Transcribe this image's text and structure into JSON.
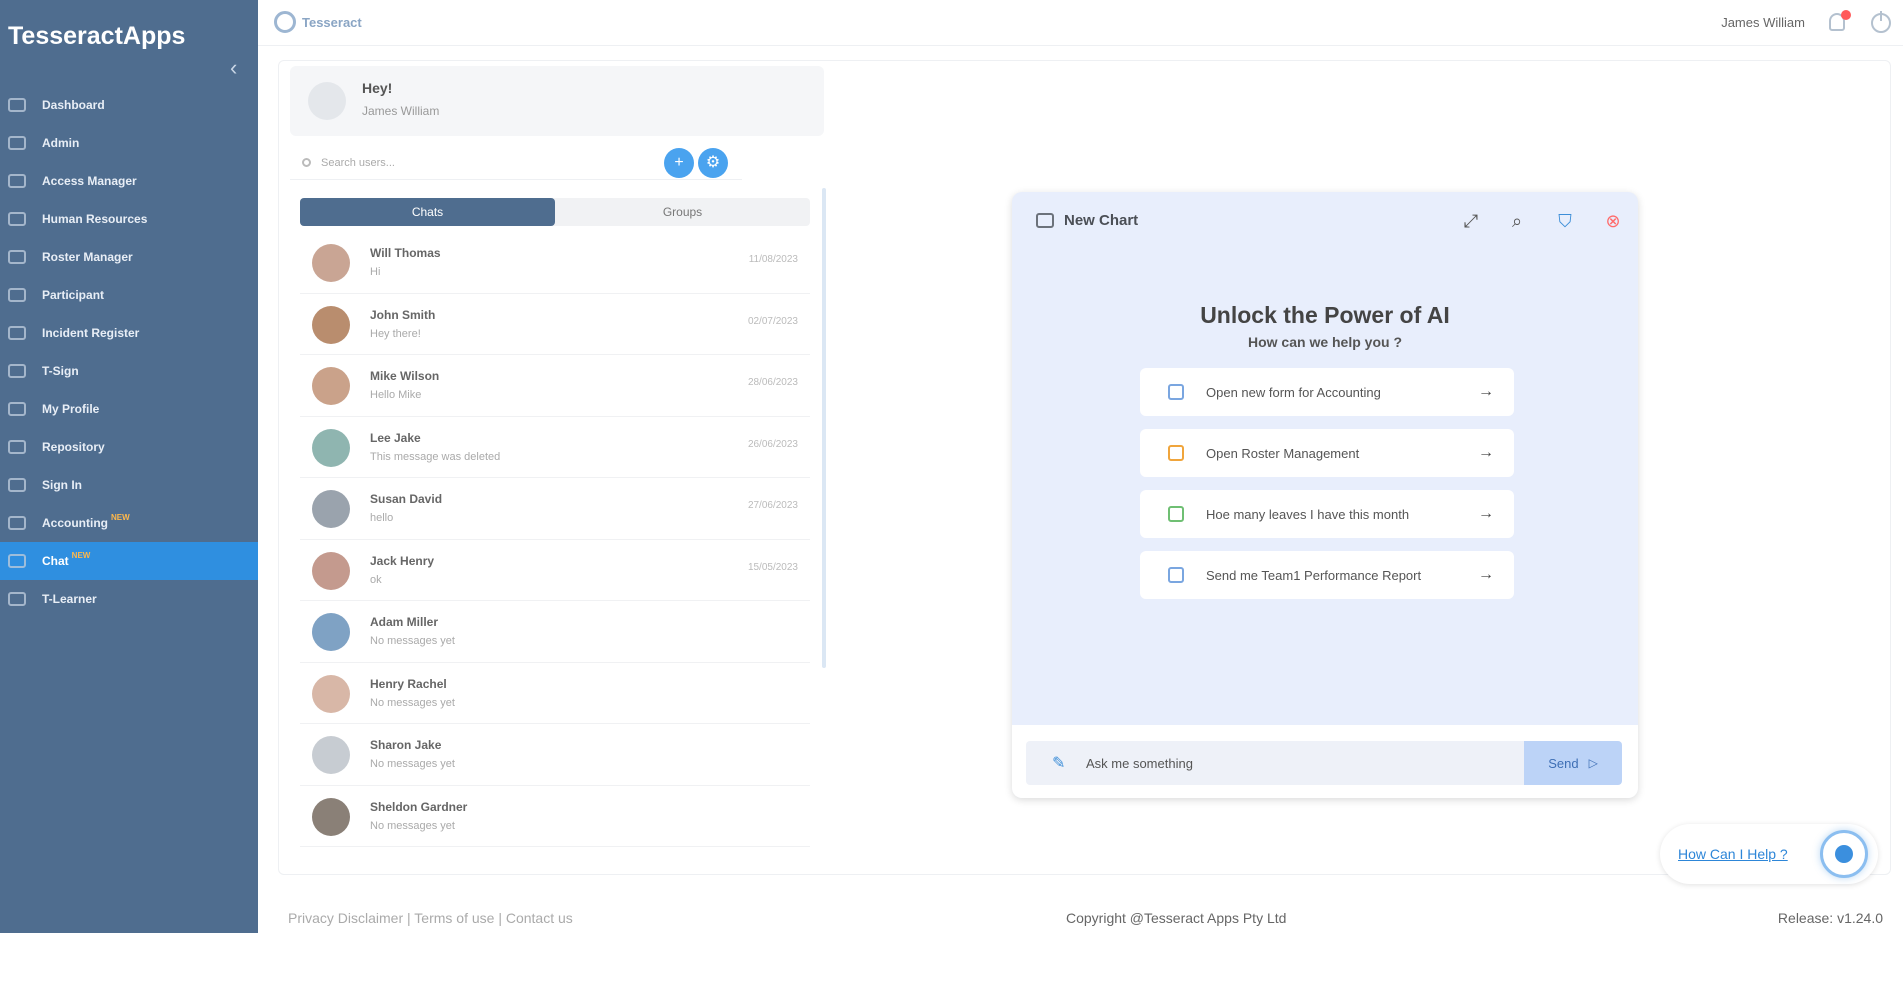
{
  "app": {
    "brand": "TesseractApps",
    "logo_text": "Tesseract"
  },
  "topbar": {
    "user_name": "James William",
    "notification_count": "1"
  },
  "sidebar": {
    "items": [
      {
        "label": "Dashboard",
        "icon": "dashboard-icon"
      },
      {
        "label": "Admin",
        "icon": "admin-icon"
      },
      {
        "label": "Access Manager",
        "icon": "access-icon"
      },
      {
        "label": "Human Resources",
        "icon": "hr-icon"
      },
      {
        "label": "Roster Manager",
        "icon": "roster-icon"
      },
      {
        "label": "Participant",
        "icon": "participant-icon"
      },
      {
        "label": "Incident Register",
        "icon": "incident-icon"
      },
      {
        "label": "T-Sign",
        "icon": "sign-icon"
      },
      {
        "label": "My Profile",
        "icon": "profile-icon"
      },
      {
        "label": "Repository",
        "icon": "repository-icon"
      },
      {
        "label": "Sign In",
        "icon": "signin-icon"
      },
      {
        "label": "Accounting",
        "icon": "accounting-icon",
        "badge": "NEW"
      },
      {
        "label": "Chat",
        "icon": "chat-icon",
        "badge": "NEW",
        "active": true
      },
      {
        "label": "T-Learner",
        "icon": "learner-icon"
      }
    ]
  },
  "chat_panel": {
    "greeting": "Hey!",
    "user_name": "James William",
    "search_placeholder": "Search users...",
    "tabs": [
      "Chats",
      "Groups"
    ],
    "conversations": [
      {
        "name": "Will Thomas",
        "message": "Hi",
        "date": "11/08/2023"
      },
      {
        "name": "John Smith",
        "message": "Hey there!",
        "date": "02/07/2023"
      },
      {
        "name": "Mike Wilson",
        "message": "Hello Mike",
        "date": "28/06/2023"
      },
      {
        "name": "Lee Jake",
        "message": "This message was deleted",
        "date": "26/06/2023"
      },
      {
        "name": "Susan David",
        "message": "hello",
        "date": "27/06/2023"
      },
      {
        "name": "Jack Henry",
        "message": "ok",
        "date": "15/05/2023"
      },
      {
        "name": "Adam Miller",
        "message": "No messages yet",
        "date": ""
      },
      {
        "name": "Henry Rachel",
        "message": "No messages yet",
        "date": ""
      },
      {
        "name": "Sharon Jake",
        "message": "No messages yet",
        "date": ""
      },
      {
        "name": "Sheldon Gardner",
        "message": "No messages yet",
        "date": ""
      }
    ]
  },
  "ai_chat": {
    "title": "New Chart",
    "heading": "Unlock the Power of AI",
    "subheading": "How can we help you ?",
    "suggestions": [
      {
        "label": "Open new form for Accounting",
        "icon": "clipboard-icon"
      },
      {
        "label": "Open Roster Management",
        "icon": "people-icon"
      },
      {
        "label": "Hoe many leaves I have this month",
        "icon": "calendar-icon"
      },
      {
        "label": "Send me Team1 Performance Report",
        "icon": "report-icon"
      }
    ],
    "input_placeholder": "Ask me something",
    "send_label": "Send"
  },
  "help": {
    "link_text": "How Can I Help ?"
  },
  "footer": {
    "links": "Privacy Disclaimer | Terms of use | Contact us",
    "copyright": "Copyright @Tesseract Apps Pty Ltd",
    "release": "Release: v1.24.0"
  },
  "colors": {
    "sidebar": "#4f6d8f",
    "accent": "#2f8fe0",
    "ai_bg": "#e8eefc"
  }
}
